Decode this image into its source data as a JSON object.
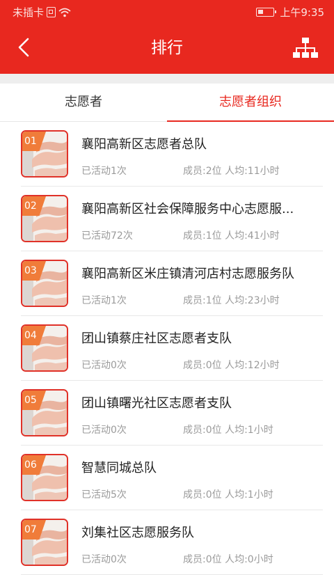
{
  "status_bar": {
    "carrier": "未插卡",
    "time": "上午9:35",
    "icons": [
      "sim-icon",
      "wifi-icon",
      "battery-icon"
    ]
  },
  "header": {
    "title": "排行",
    "back_icon": "back-arrow-icon",
    "org_icon": "org-chart-icon"
  },
  "tabs": [
    {
      "label": "志愿者",
      "active": false
    },
    {
      "label": "志愿者组织",
      "active": true
    }
  ],
  "colors": {
    "brand_red": "#e8281f",
    "rank_badge": "#f07c3a",
    "text_primary": "#222222",
    "text_secondary": "#9a9a9a"
  },
  "ranking": [
    {
      "rank": "01",
      "name": "襄阳高新区志愿者总队",
      "activity": "已活动1次",
      "members": "成员:2位 人均:11小时"
    },
    {
      "rank": "02",
      "name": "襄阳高新区社会保障服务中心志愿服...",
      "activity": "已活动72次",
      "members": "成员:1位 人均:41小时"
    },
    {
      "rank": "03",
      "name": "襄阳高新区米庄镇清河店村志愿服务队",
      "activity": "已活动1次",
      "members": "成员:1位 人均:23小时"
    },
    {
      "rank": "04",
      "name": "团山镇蔡庄社区志愿者支队",
      "activity": "已活动0次",
      "members": "成员:0位 人均:12小时"
    },
    {
      "rank": "05",
      "name": "团山镇曙光社区志愿者支队",
      "activity": "已活动0次",
      "members": "成员:0位 人均:1小时"
    },
    {
      "rank": "06",
      "name": "智慧同城总队",
      "activity": "已活动5次",
      "members": "成员:0位 人均:1小时"
    },
    {
      "rank": "07",
      "name": "刘集社区志愿服务队",
      "activity": "已活动0次",
      "members": "成员:0位 人均:0小时"
    }
  ]
}
